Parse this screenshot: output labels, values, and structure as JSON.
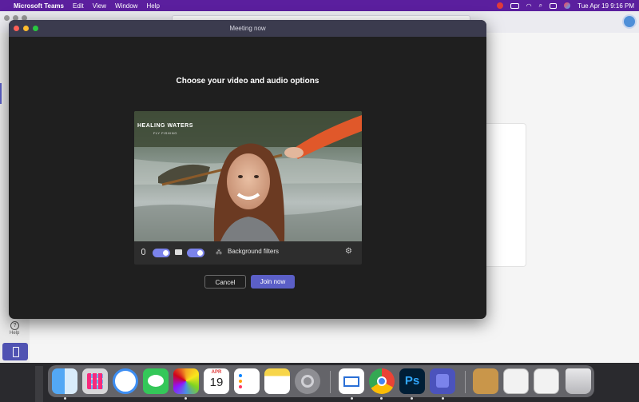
{
  "menubar": {
    "app_name": "Microsoft Teams",
    "menus": [
      "Edit",
      "View",
      "Window",
      "Help"
    ],
    "datetime": "Tue Apr 19  9:16 PM"
  },
  "modal": {
    "title": "Meeting now",
    "heading": "Choose your video and audio options",
    "video_overlay_logo": "HEALING WATERS",
    "video_overlay_sub": "FLY FISHING",
    "mic_on": true,
    "camera_on": true,
    "background_filters_label": "Background filters",
    "cancel_label": "Cancel",
    "join_label": "Join now"
  },
  "sidebar": {
    "help_label": "Help"
  },
  "dock": {
    "calendar_month": "APR",
    "calendar_day": "19",
    "photoshop_label": "Ps",
    "apps": [
      "finder",
      "launchpad",
      "safari",
      "messages",
      "photos",
      "calendar",
      "reminders",
      "notes",
      "system-preferences",
      "mail",
      "chrome",
      "photoshop",
      "teams",
      "archive",
      "documents",
      "downloads",
      "trash"
    ]
  },
  "colors": {
    "menubar": "#5b1f9e",
    "accent": "#5b5fc7",
    "toggle": "#7b83eb"
  }
}
